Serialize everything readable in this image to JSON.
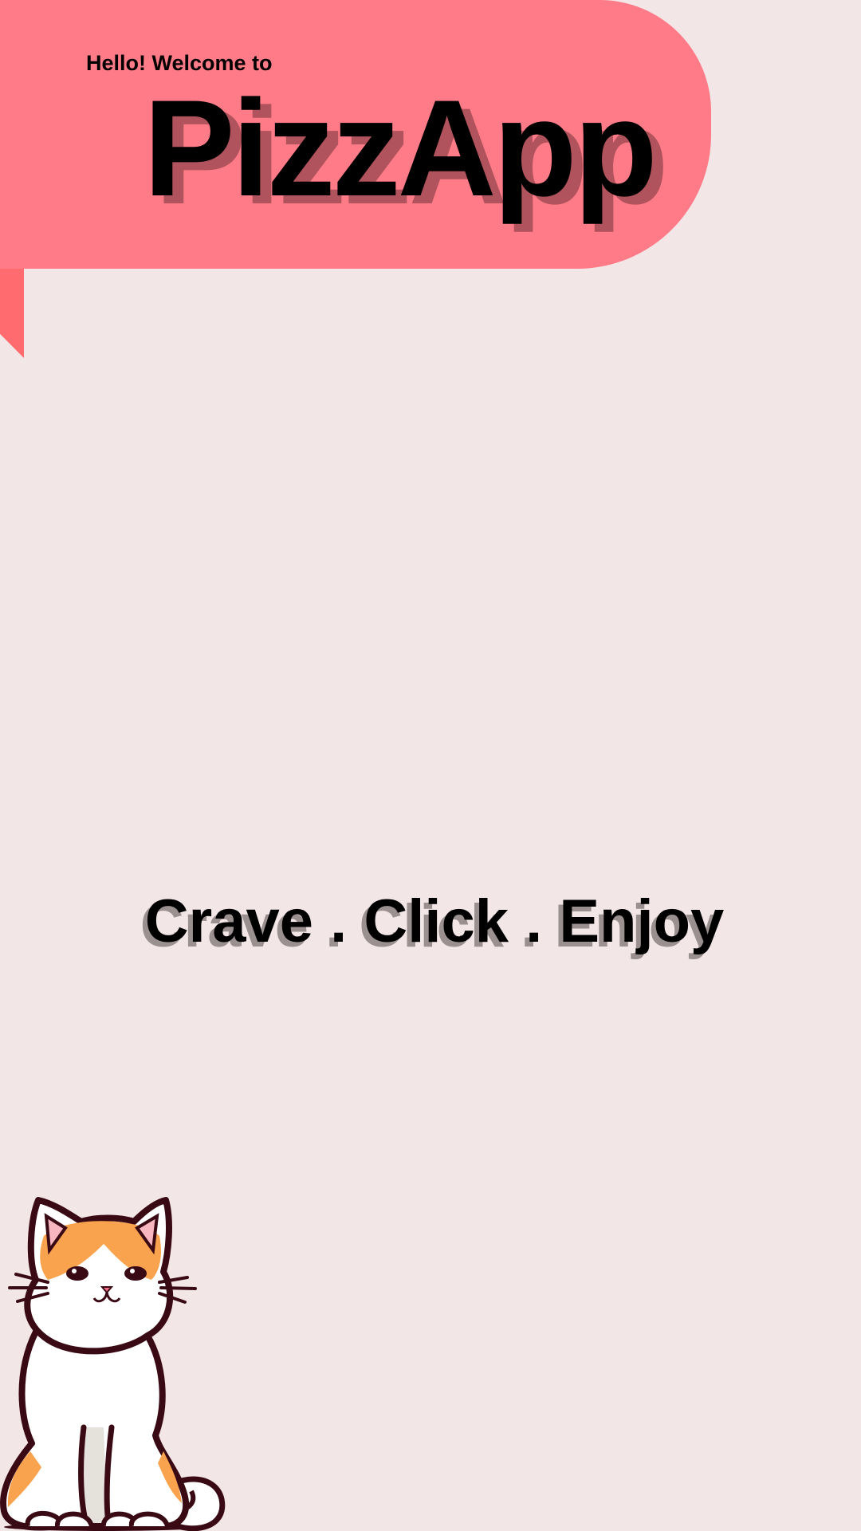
{
  "colors": {
    "background": "#f3e6e7",
    "banner": "#ff7b87",
    "ribbon_fold": "#ff6b6e",
    "title_shadow": "#b0535c",
    "tagline_shadow": "#9a9090",
    "text": "#000000"
  },
  "header": {
    "greeting": "Hello! Welcome to",
    "app_name": "PizzApp"
  },
  "main": {
    "tagline": "Crave . Click . Enjoy"
  },
  "illustration": {
    "icon": "cat-mascot"
  }
}
